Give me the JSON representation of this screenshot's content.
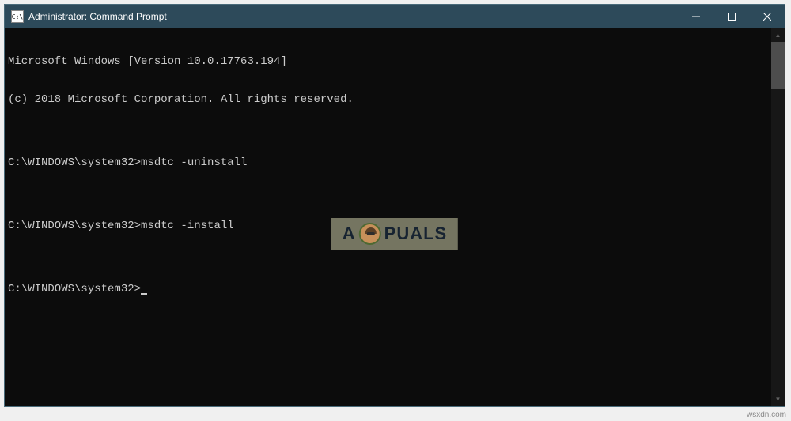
{
  "titlebar": {
    "icon_label": "C:\\",
    "title": "Administrator: Command Prompt"
  },
  "console": {
    "lines": [
      "Microsoft Windows [Version 10.0.17763.194]",
      "(c) 2018 Microsoft Corporation. All rights reserved.",
      "",
      "C:\\WINDOWS\\system32>msdtc -uninstall",
      "",
      "C:\\WINDOWS\\system32>msdtc -install",
      "",
      "C:\\WINDOWS\\system32>"
    ]
  },
  "watermark": {
    "prefix": "A",
    "suffix": "PUALS"
  },
  "attribution": "wsxdn.com"
}
